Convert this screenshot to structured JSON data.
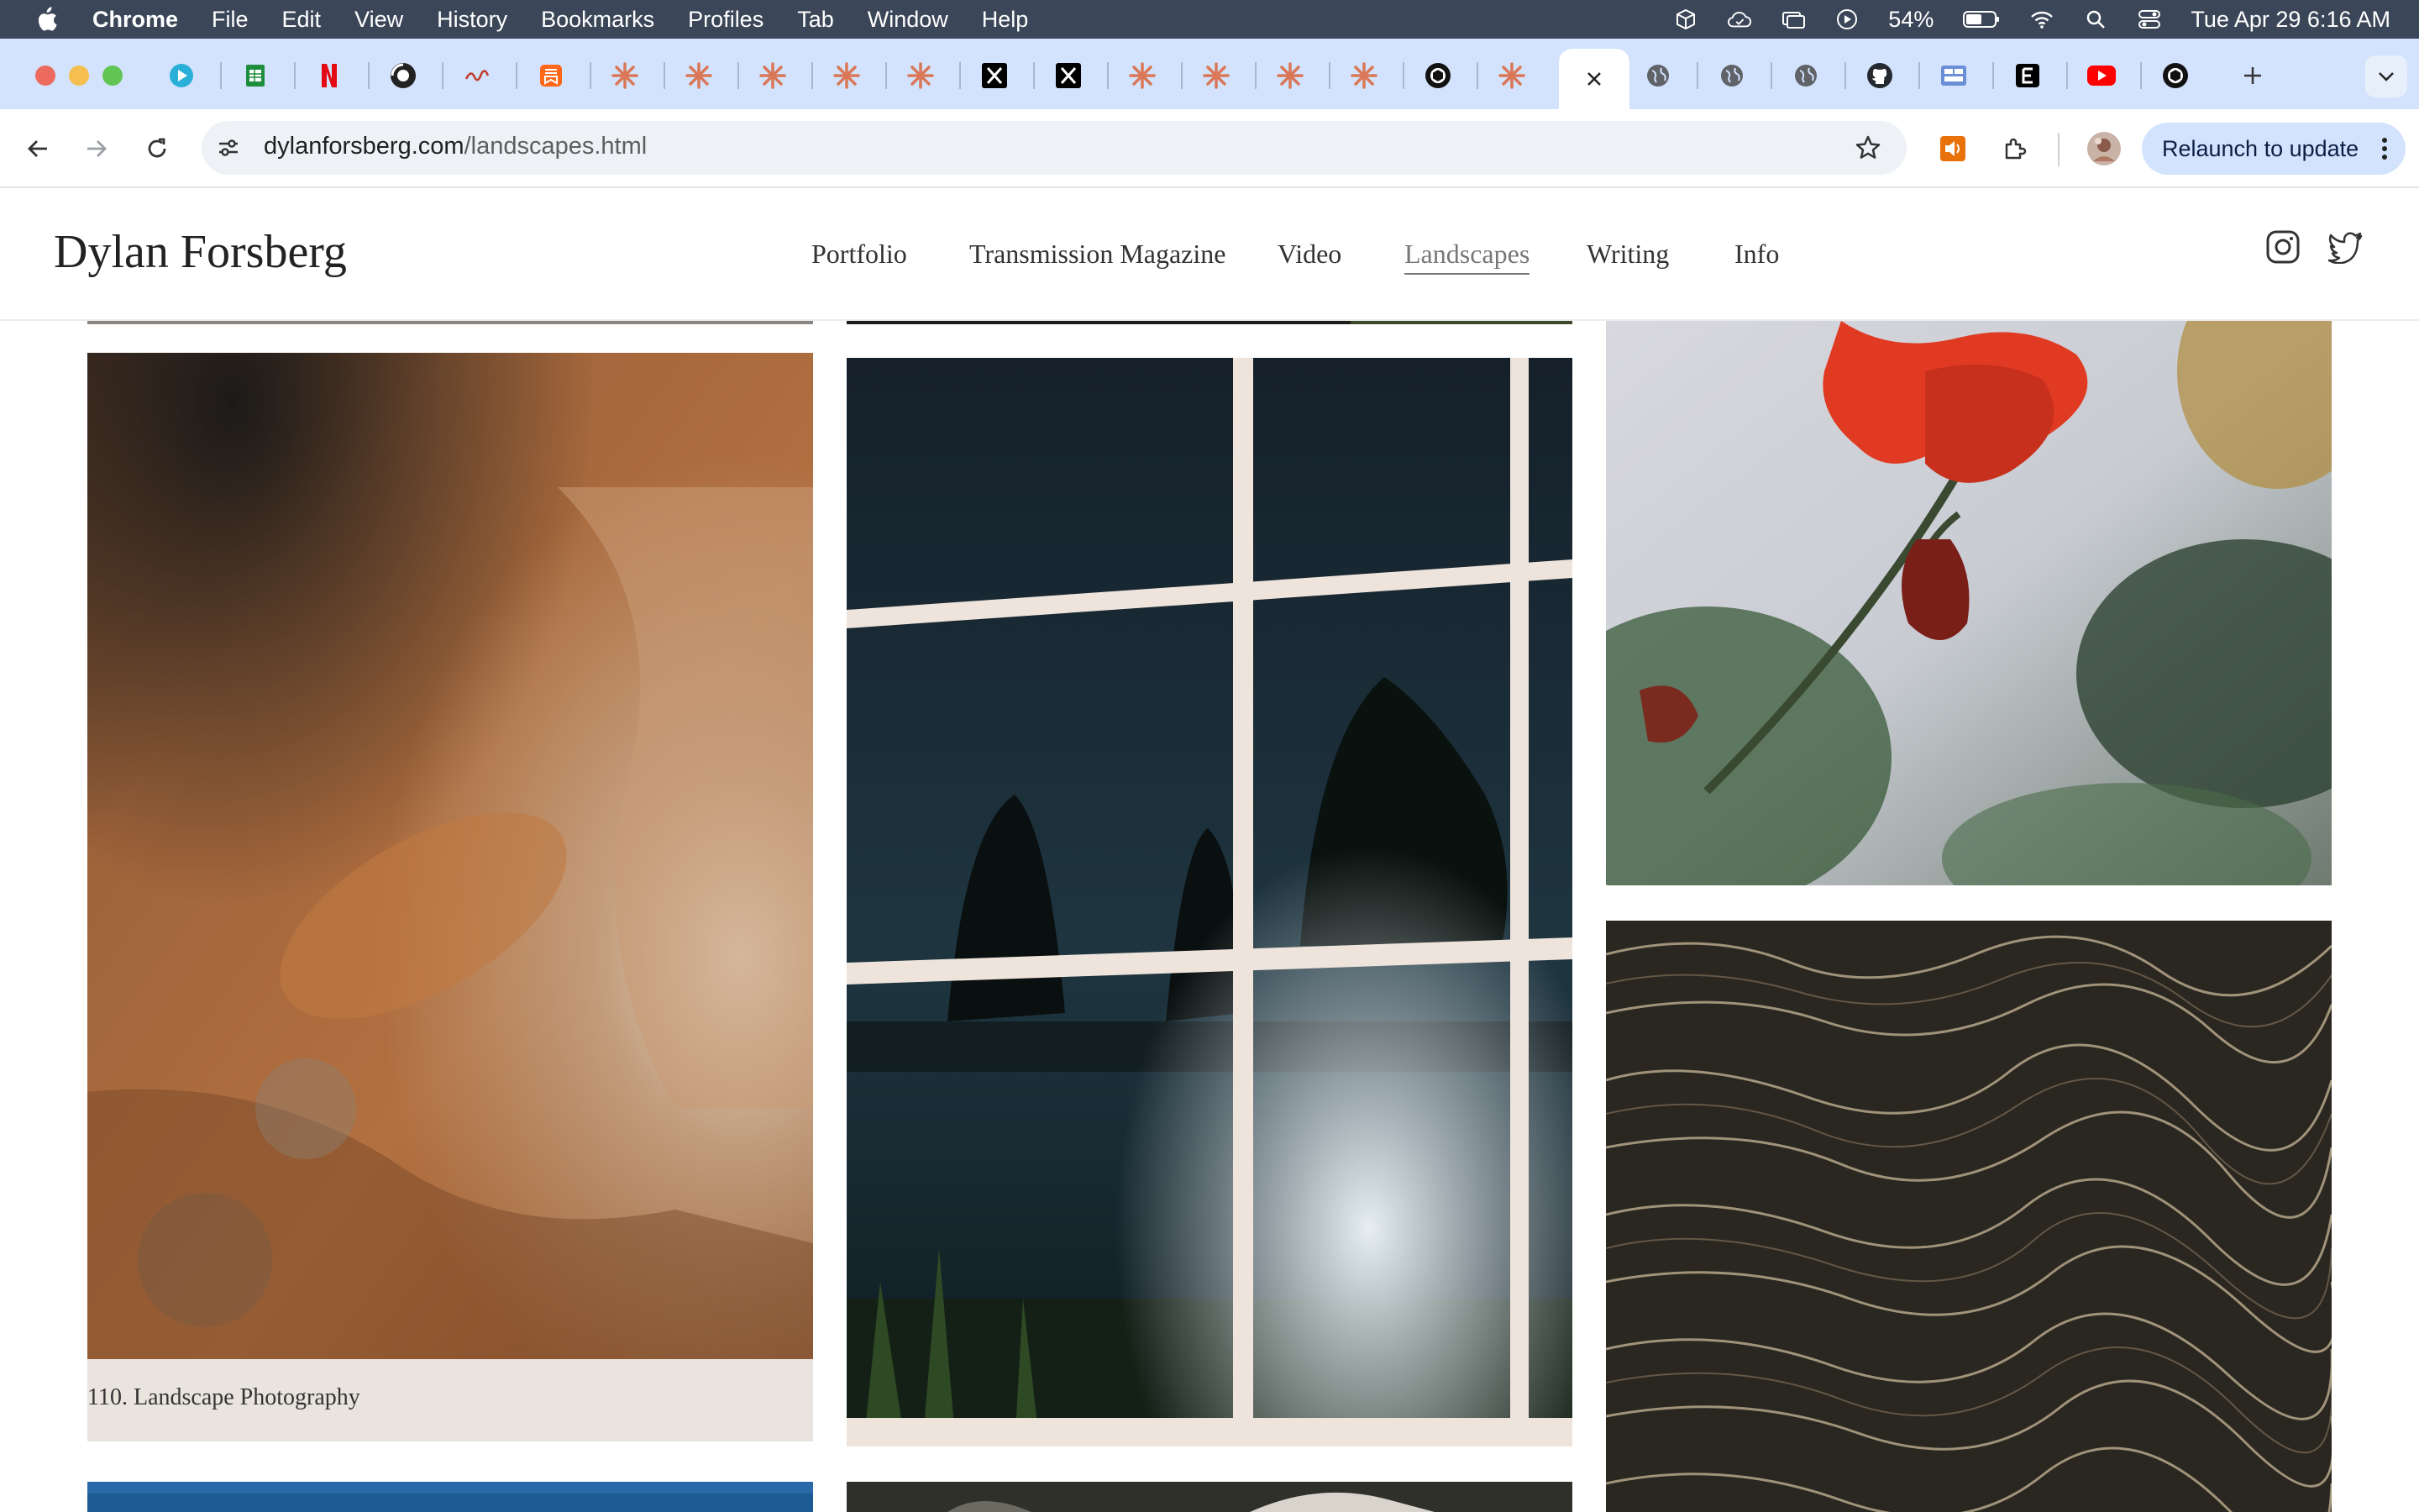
{
  "menubar": {
    "app_name": "Chrome",
    "menus": [
      "File",
      "Edit",
      "View",
      "History",
      "Bookmarks",
      "Profiles",
      "Tab",
      "Window",
      "Help"
    ],
    "battery_percent": "54%",
    "datetime": "Tue Apr 29  6:16 AM"
  },
  "browser": {
    "url_host": "dylanforsberg.com",
    "url_path": "/landscapes.html",
    "relaunch_label": "Relaunch to update"
  },
  "site": {
    "title": "Dylan Forsberg",
    "nav": [
      "Portfolio",
      "Transmission Magazine",
      "Video",
      "Landscapes",
      "Writing",
      "Info"
    ],
    "active_nav": "Landscapes"
  },
  "gallery": {
    "caption": "110. Landscape Photography"
  },
  "colors": {
    "menubar_bg": "#3b4658",
    "tabstrip_bg": "#d3e3fd",
    "accent": "#0b57d0"
  }
}
